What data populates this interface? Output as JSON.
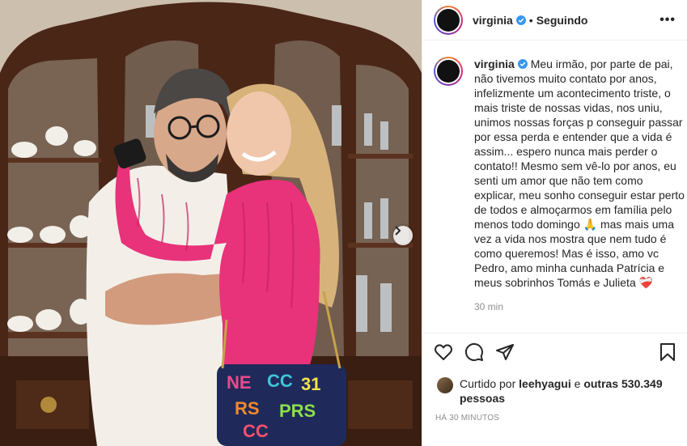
{
  "header": {
    "username": "virginia",
    "separator": "•",
    "follow_status": "Seguindo",
    "more_label": "•••"
  },
  "caption": {
    "username": "virginia",
    "text": "Meu irmão, por parte de pai, não tivemos muito contato por anos, infelizmente um acontecimento triste, o mais triste de nossas vidas, nos uniu, unimos nossas forças p conseguir passar por essa perda e entender que a vida é assim... espero nunca mais perder o contato!! Mesmo sem vê-lo por anos, eu senti um amor que não tem como explicar, meu sonho conseguir estar perto de todos e almoçarmos em família pelo menos todo domingo 🙏 mas mais uma vez a vida nos mostra que nem tudo é como queremos! Mas é isso, amo vc Pedro, amo minha cunhada Patrícia e meus sobrinhos Tomás e Julieta ❤️‍🩹",
    "time": "30 min"
  },
  "likes": {
    "prefix": "Curtido por ",
    "user": "leehyagui",
    "conj": " e ",
    "others": "outras 530.349 pessoas"
  },
  "post_date": "HÁ 30 MINUTOS",
  "icons": {
    "verified": "verified-badge-icon",
    "like": "heart-icon",
    "comment": "comment-icon",
    "share": "paper-plane-icon",
    "save": "bookmark-icon",
    "next": "chevron-right-icon"
  },
  "colors": {
    "verified": "#3897f0",
    "text": "#262626",
    "muted": "#8e8e8e",
    "border": "#efefef"
  }
}
